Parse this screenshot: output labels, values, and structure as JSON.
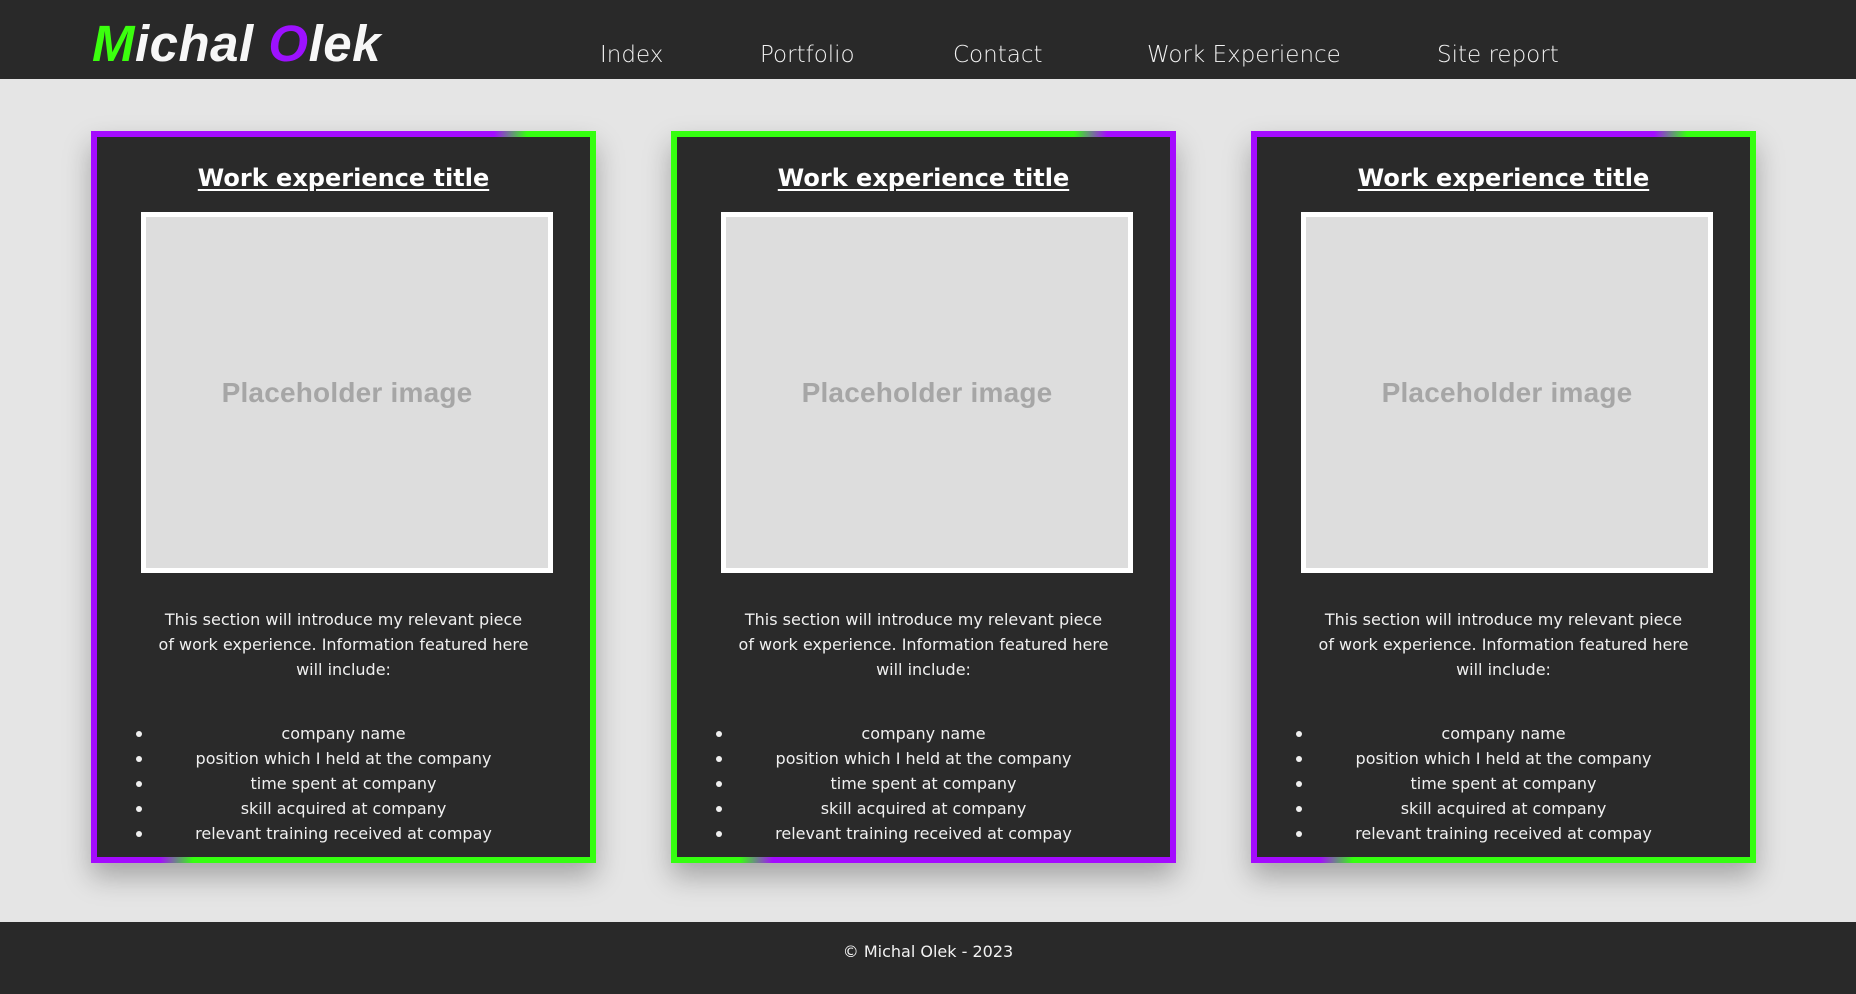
{
  "site": {
    "logo_first_initial": "M",
    "logo_first_rest": "ichal",
    "logo_last_initial": "O",
    "logo_last_rest": "lek"
  },
  "nav": {
    "items": [
      {
        "label": "Index"
      },
      {
        "label": "Portfolio"
      },
      {
        "label": "Contact"
      },
      {
        "label": "Work Experience"
      },
      {
        "label": "Site report"
      }
    ]
  },
  "cards": [
    {
      "title": "Work experience title",
      "image_label": "Placeholder image",
      "description": "This section will introduce my relevant piece of work experience. Information featured here will include:",
      "items": [
        "company name",
        "position which I held at the company",
        "time spent at company",
        "skill acquired at company",
        "relevant training received at compay"
      ]
    },
    {
      "title": "Work experience title",
      "image_label": "Placeholder image",
      "description": "This section will introduce my relevant piece of work experience. Information featured here will include:",
      "items": [
        "company name",
        "position which I held at the company",
        "time spent at company",
        "skill acquired at company",
        "relevant training received at compay"
      ]
    },
    {
      "title": "Work experience title",
      "image_label": "Placeholder image",
      "description": "This section will introduce my relevant piece of work experience. Information featured here will include:",
      "items": [
        "company name",
        "position which I held at the company",
        "time spent at company",
        "skill acquired at company",
        "relevant training received at compay"
      ]
    }
  ],
  "footer": {
    "copyright": "© Michal Olek - 2023"
  },
  "colors": {
    "accent_green": "#35ff10",
    "accent_purple": "#a40bff",
    "bar_background": "#292929",
    "card_background": "#2a2a2a",
    "page_background": "#e5e5e5"
  }
}
